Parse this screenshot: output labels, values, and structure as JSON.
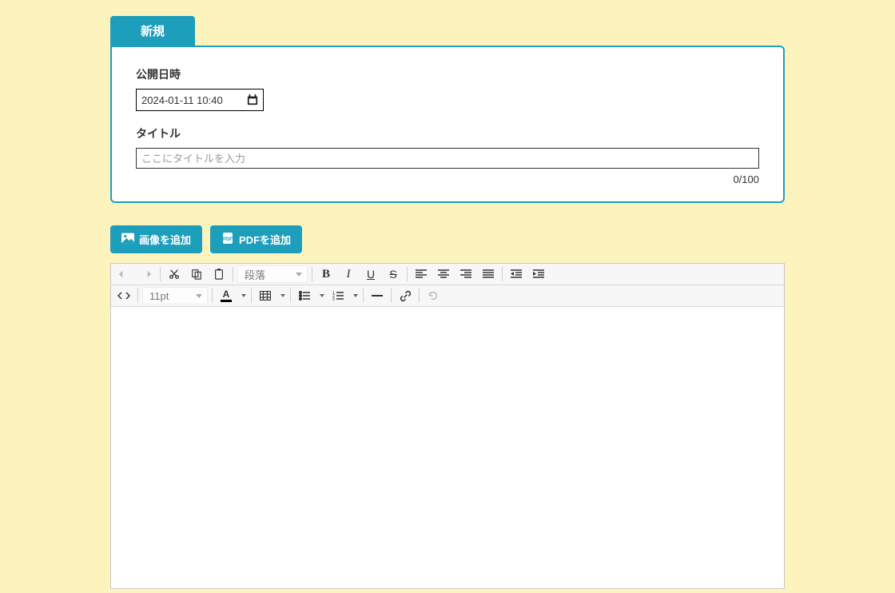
{
  "tab": {
    "label": "新規"
  },
  "form": {
    "datetime_label": "公開日時",
    "datetime_value": "2024-01-11 10:40",
    "title_label": "タイトル",
    "title_placeholder": "ここにタイトルを入力",
    "title_value": "",
    "char_count": "0/100"
  },
  "buttons": {
    "add_image": "画像を追加",
    "add_pdf": "PDFを追加"
  },
  "editor": {
    "format_select": "段落",
    "fontsize_select": "11pt"
  }
}
